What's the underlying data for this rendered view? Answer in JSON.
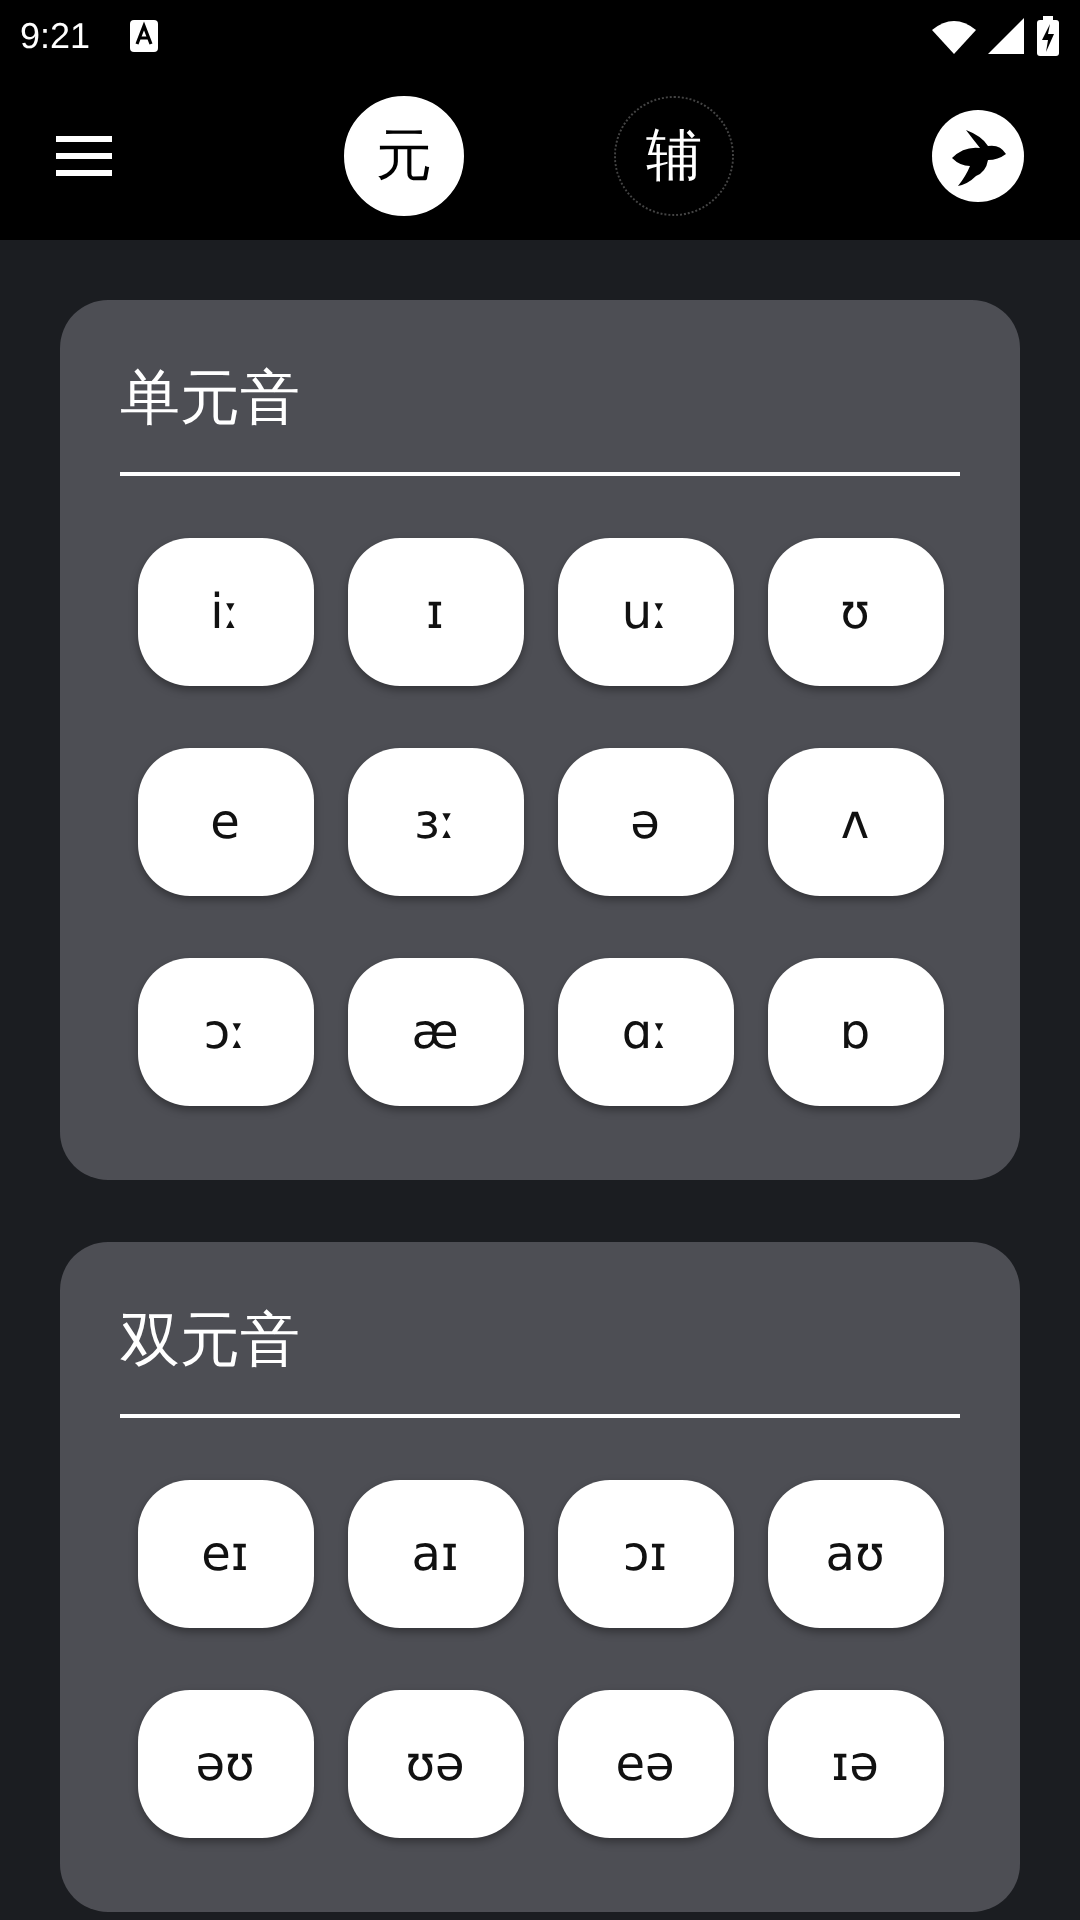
{
  "status_bar": {
    "time": "9:21"
  },
  "tabs": [
    {
      "label": "元",
      "selected": true
    },
    {
      "label": "辅",
      "selected": false
    }
  ],
  "sections": [
    {
      "title": "单元音",
      "sounds": [
        "iː",
        "ɪ",
        "uː",
        "ʊ",
        "e",
        "ɜː",
        "ə",
        "ʌ",
        "ɔː",
        "æ",
        "ɑː",
        "ɒ"
      ]
    },
    {
      "title": "双元音",
      "sounds": [
        "eɪ",
        "aɪ",
        "ɔɪ",
        "aʊ",
        "əʊ",
        "ʊə",
        "eə",
        "ɪə"
      ]
    }
  ]
}
